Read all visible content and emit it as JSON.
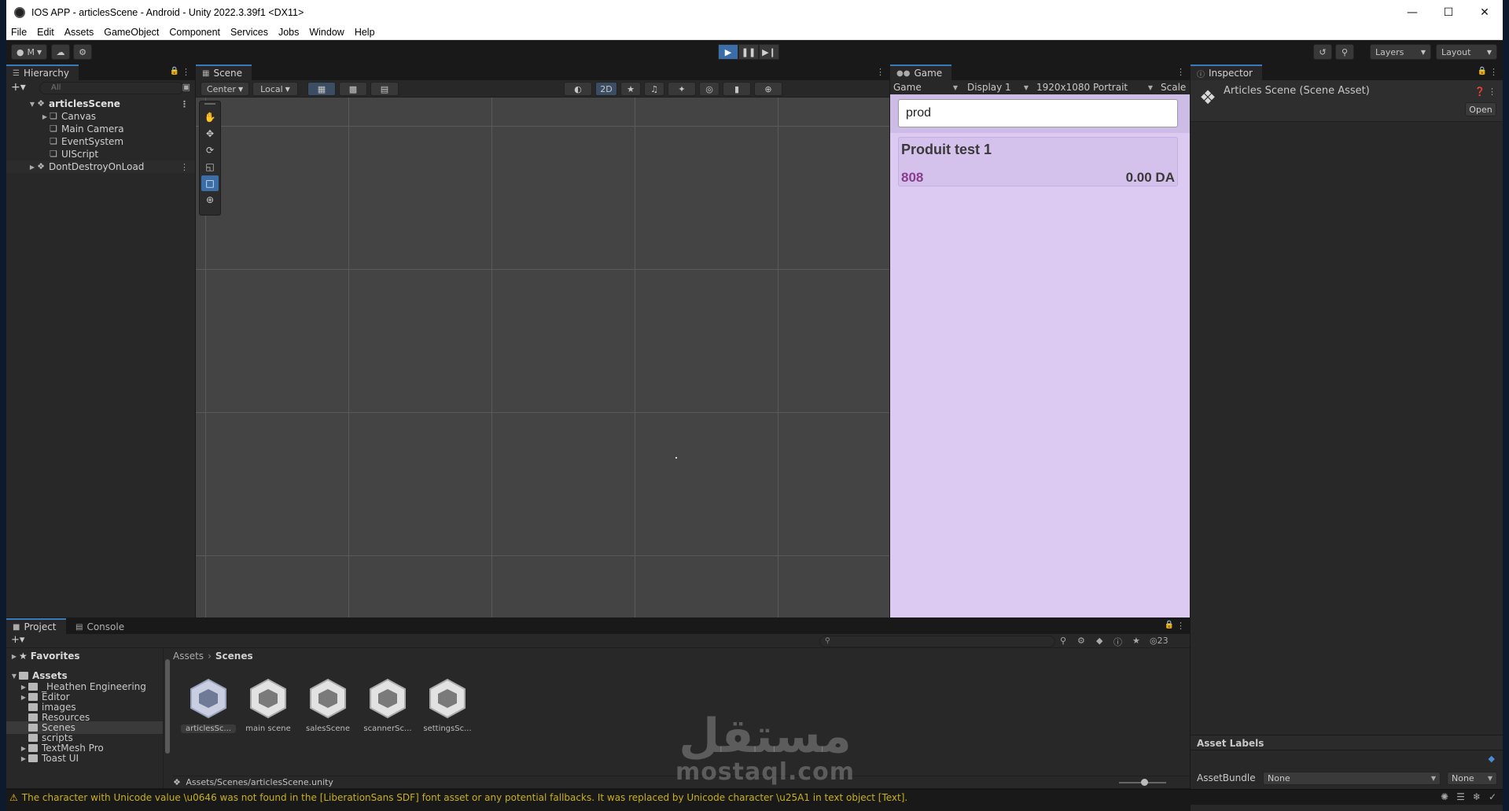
{
  "window": {
    "title": "IOS APP - articlesScene - Android - Unity 2022.3.39f1 <DX11>"
  },
  "menu": [
    "File",
    "Edit",
    "Assets",
    "GameObject",
    "Component",
    "Services",
    "Jobs",
    "Window",
    "Help"
  ],
  "toolbar": {
    "account_label": "M",
    "layers_label": "Layers",
    "layout_label": "Layout"
  },
  "hierarchy": {
    "tab": "Hierarchy",
    "search_placeholder": "All",
    "scene_name": "articlesScene",
    "children": [
      "Canvas",
      "Main Camera",
      "EventSystem",
      "UIScript"
    ],
    "ddol": "DontDestroyOnLoad"
  },
  "scene": {
    "tab": "Scene",
    "pivot_label": "Center",
    "space_label": "Local",
    "mode_2d": "2D"
  },
  "game": {
    "tab": "Game",
    "view_label": "Game",
    "display_label": "Display 1",
    "resolution_label": "1920x1080 Portrait",
    "scale_label": "Scale",
    "search_value": "prod",
    "product": {
      "name": "Produit test 1",
      "code": "808",
      "price": "0.00 DA"
    }
  },
  "inspector": {
    "tab": "Inspector",
    "title": "Articles Scene (Scene Asset)",
    "open_label": "Open",
    "asset_labels": "Asset Labels",
    "asset_bundle_label": "AssetBundle",
    "asset_bundle_value": "None",
    "variant_value": "None"
  },
  "project": {
    "tab": "Project",
    "console_tab": "Console",
    "hidden_count": "23",
    "favorites": "Favorites",
    "assets_root": "Assets",
    "folders": [
      "_Heathen Engineering",
      "Editor",
      "images",
      "Resources",
      "Scenes",
      "scripts",
      "TextMesh Pro",
      "Toast UI"
    ],
    "breadcrumb": [
      "Assets",
      "Scenes"
    ],
    "assets": [
      "articlesSc...",
      "main scene",
      "salesScene",
      "scannerSc...",
      "settingsSc..."
    ],
    "path": "Assets/Scenes/articlesScene.unity"
  },
  "watermark": {
    "arabic": "مستقل",
    "latin": "mostaql.com"
  },
  "status": {
    "message": "The character with Unicode value \\u0646 was not found in the [LiberationSans SDF] font asset or any potential fallbacks. It was replaced by Unicode character \\u25A1 in text object [Text]."
  },
  "colors": {
    "accent": "#3b6ea8",
    "game_bg": "#dccaf3",
    "product_code": "#8a3c8e"
  }
}
